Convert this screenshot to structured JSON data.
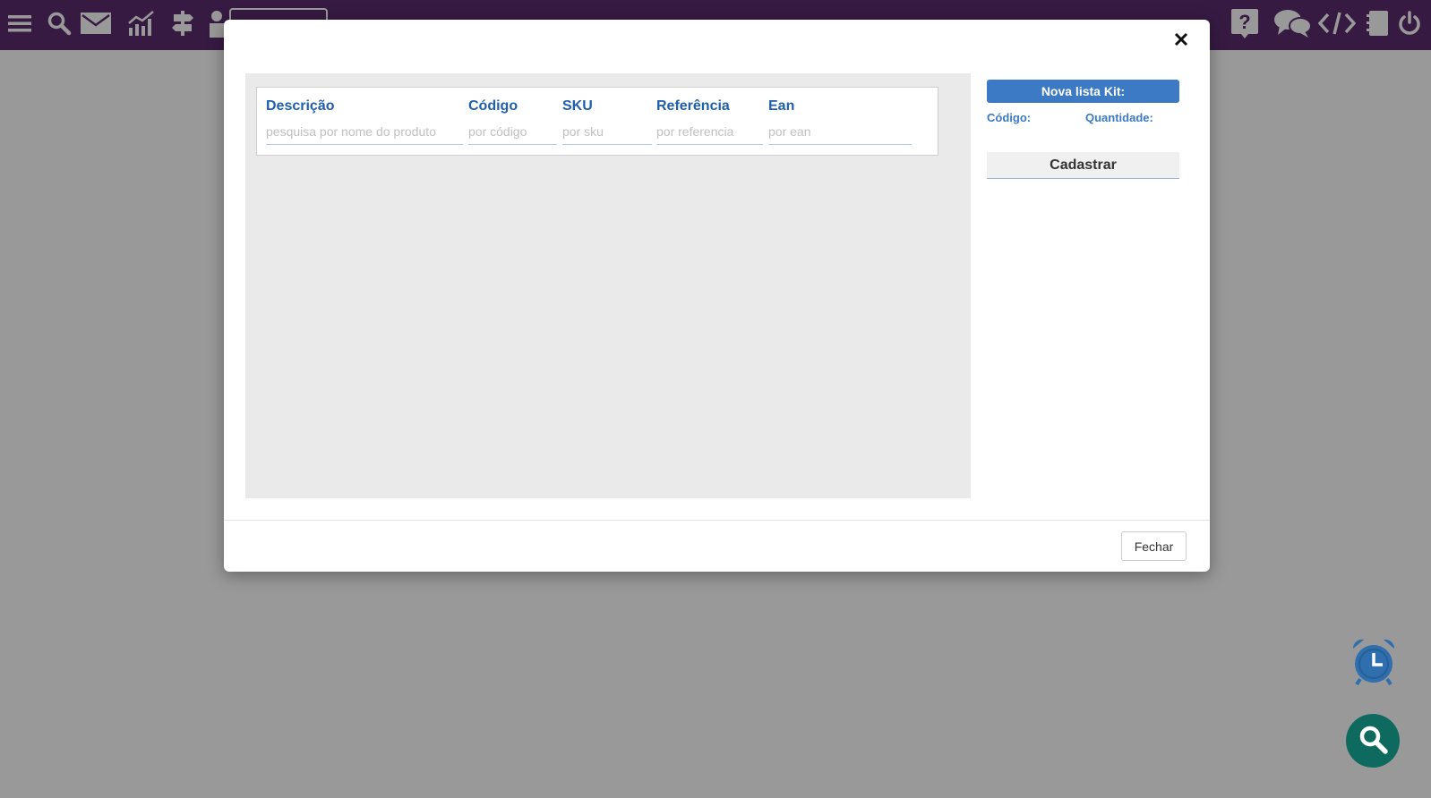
{
  "topbar": {
    "left_icons": [
      "menu-icon",
      "search-icon",
      "mail-icon",
      "chart-icon",
      "signpost-icon",
      "user-icon"
    ],
    "right_icons": [
      "help-icon",
      "chat-icon",
      "code-icon",
      "notebook-icon",
      "power-icon"
    ],
    "accent_color": "#5b2c6f"
  },
  "modal": {
    "filters": [
      {
        "label": "Descrição",
        "placeholder": "pesquisa por nome do produto"
      },
      {
        "label": "Código",
        "placeholder": "por código"
      },
      {
        "label": "SKU",
        "placeholder": "por sku"
      },
      {
        "label": "Referência",
        "placeholder": "por referencia"
      },
      {
        "label": "Ean",
        "placeholder": "por ean"
      }
    ],
    "kit": {
      "title": "Nova lista Kit:",
      "code_label": "Código:",
      "quantity_label": "Quantidade:",
      "register_label": "Cadastrar"
    },
    "close_label": "Fechar",
    "accent_color": "#3c7ac5"
  },
  "floating": {
    "alarm_icon": "alarm-clock-icon",
    "search_icon": "search-icon",
    "search_color": "#0e6a5e"
  }
}
